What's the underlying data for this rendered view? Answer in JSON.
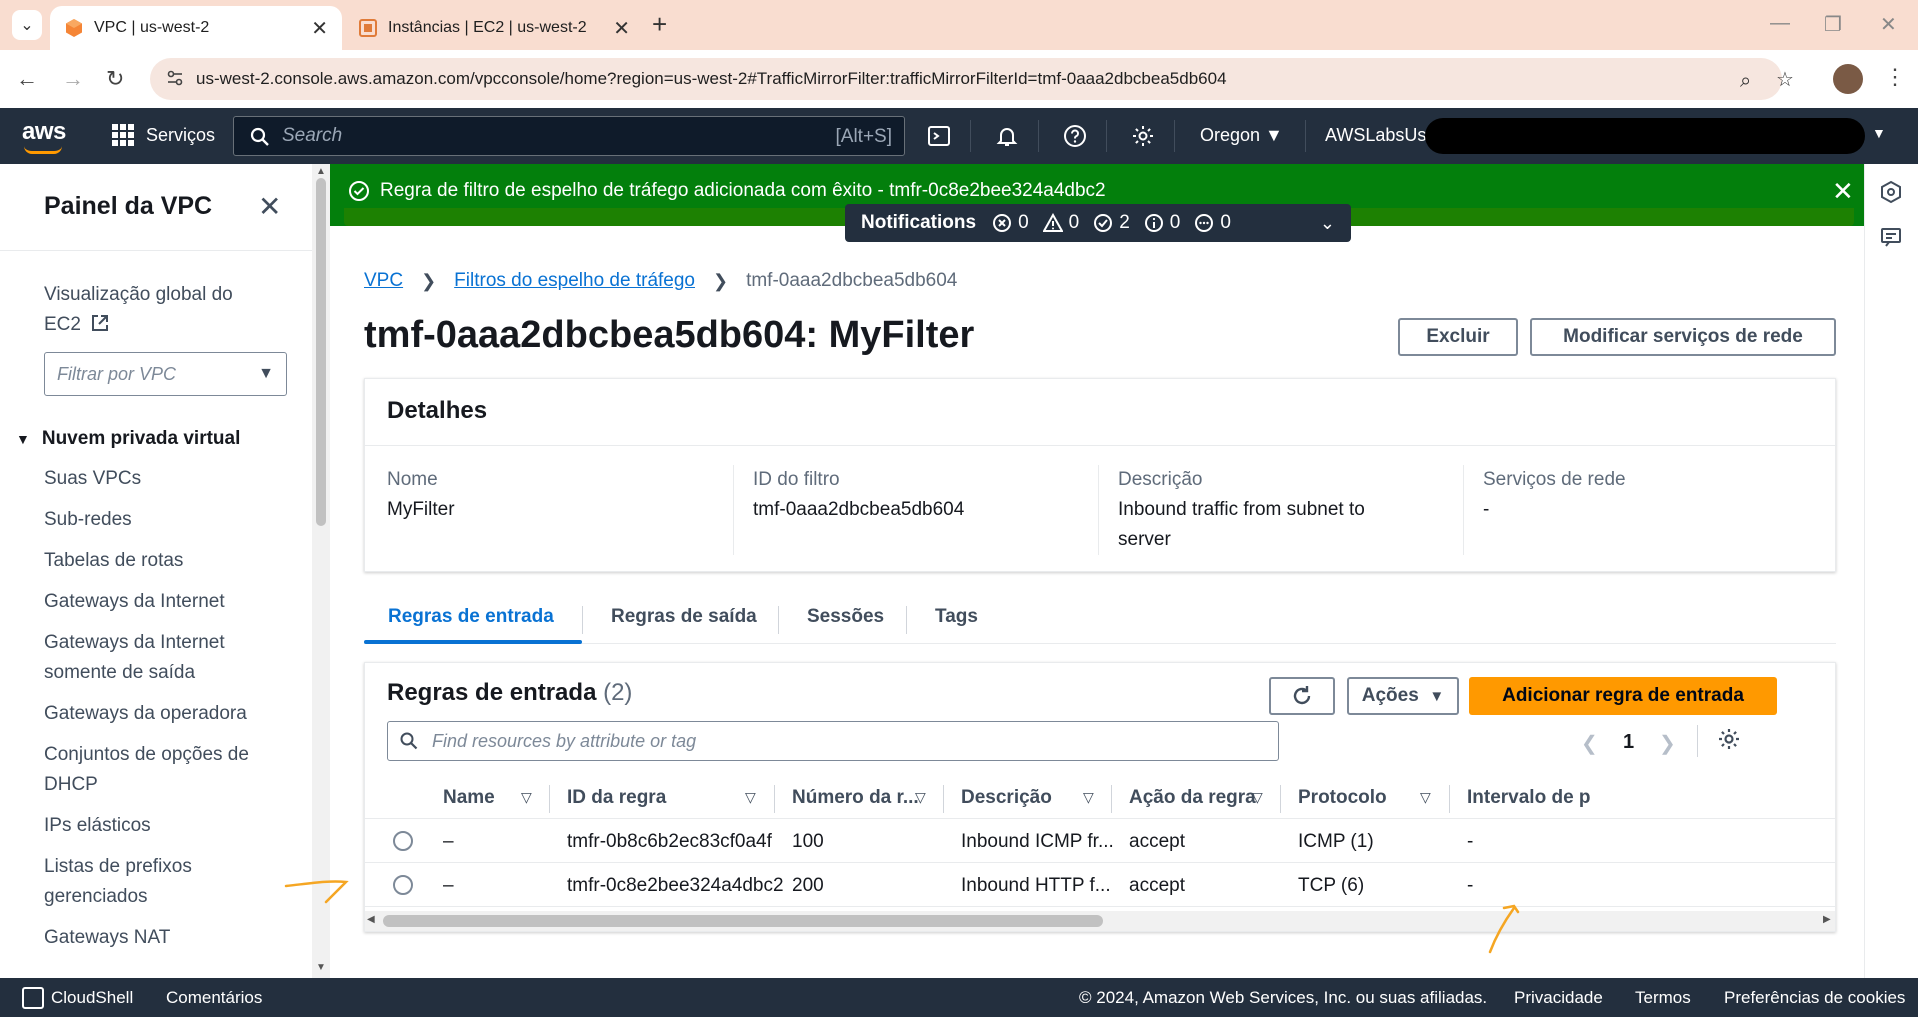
{
  "browser": {
    "tabs": [
      {
        "title": "VPC | us-west-2",
        "active": true
      },
      {
        "title": "Instâncias | EC2 | us-west-2",
        "active": false
      }
    ],
    "url": "us-west-2.console.aws.amazon.com/vpcconsole/home?region=us-west-2#TrafficMirrorFilter:trafficMirrorFilterId=tmf-0aaa2dbcbea5db604"
  },
  "aws_header": {
    "logo": "aws",
    "services_label": "Serviços",
    "search_placeholder": "Search",
    "search_shortcut": "[Alt+S]",
    "region": "Oregon",
    "account": "AWSLabsUse"
  },
  "sidebar": {
    "title": "Painel da VPC",
    "global_view": "Visualização global do EC2",
    "filter_placeholder": "Filtrar por VPC",
    "section": "Nuvem privada virtual",
    "items": [
      "Suas VPCs",
      "Sub-redes",
      "Tabelas de rotas",
      "Gateways da Internet",
      "Gateways da Internet somente de saída",
      "Gateways da operadora",
      "Conjuntos de opções de DHCP",
      "IPs elásticos",
      "Listas de prefixos gerenciados",
      "Gateways NAT"
    ]
  },
  "flash": {
    "message": "Regra de filtro de espelho de tráfego adicionada com êxito - tmfr-0c8e2bee324a4dbc2"
  },
  "notifications": {
    "label": "Notifications",
    "counts": {
      "error": "0",
      "warning": "0",
      "success": "2",
      "info": "0",
      "pending": "0"
    }
  },
  "breadcrumb": {
    "vpc": "VPC",
    "filters": "Filtros do espelho de tráfego",
    "current": "tmf-0aaa2dbcbea5db604"
  },
  "page": {
    "title": "tmf-0aaa2dbcbea5db604: MyFilter",
    "delete_button": "Excluir",
    "modify_button": "Modificar serviços de rede"
  },
  "details": {
    "title": "Detalhes",
    "name_label": "Nome",
    "name_value": "MyFilter",
    "id_label": "ID do filtro",
    "id_value": "tmf-0aaa2dbcbea5db604",
    "desc_label": "Descrição",
    "desc_value": "Inbound traffic from subnet to server",
    "services_label": "Serviços de rede",
    "services_value": "-"
  },
  "tabs": [
    "Regras de entrada",
    "Regras de saída",
    "Sessões",
    "Tags"
  ],
  "rules_table": {
    "title": "Regras de entrada",
    "count": "(2)",
    "actions_button": "Ações",
    "add_button": "Adicionar regra de entrada",
    "search_placeholder": "Find resources by attribute or tag",
    "page": "1",
    "columns": [
      "Name",
      "ID da regra",
      "Número da r...",
      "Descrição",
      "Ação da regra",
      "Protocolo",
      "Intervalo de p"
    ],
    "rows": [
      {
        "name": "–",
        "id": "tmfr-0b8c6b2ec83cf0a4f",
        "number": "100",
        "description": "Inbound ICMP fr...",
        "action": "accept",
        "protocol": "ICMP (1)",
        "range": "-"
      },
      {
        "name": "–",
        "id": "tmfr-0c8e2bee324a4dbc2",
        "number": "200",
        "description": "Inbound HTTP f...",
        "action": "accept",
        "protocol": "TCP (6)",
        "range": "-"
      }
    ]
  },
  "footer": {
    "cloudshell": "CloudShell",
    "feedback": "Comentários",
    "copyright": "© 2024, Amazon Web Services, Inc. ou suas afiliadas.",
    "privacy": "Privacidade",
    "terms": "Termos",
    "cookies": "Preferências de cookies"
  },
  "colors": {
    "aws_dark": "#232f3e",
    "link_blue": "#0972d3",
    "success_green": "#037f0c",
    "primary_orange": "#ff9900",
    "annotation_orange": "#f5a623"
  }
}
